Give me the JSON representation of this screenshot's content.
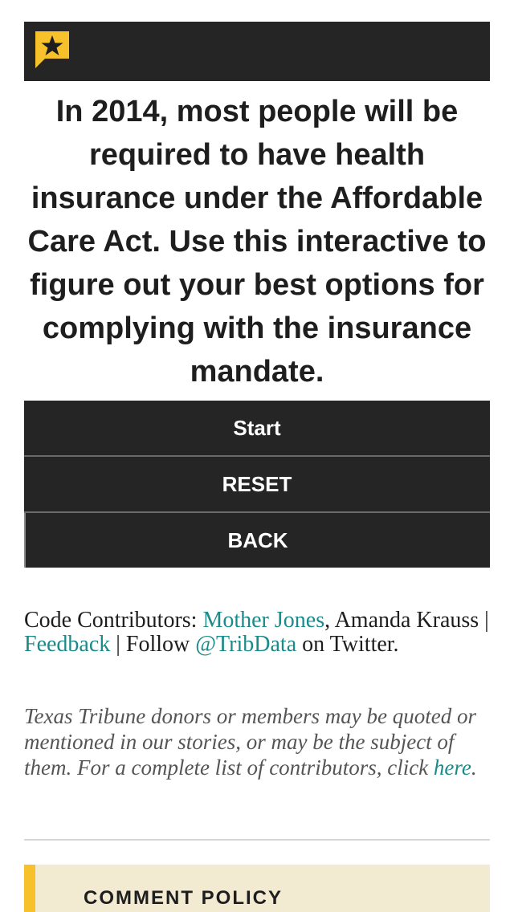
{
  "intro": {
    "text": "In 2014, most people will be required to have health insurance under the Affordable Care Act. Use this interactive to figure out your best options for complying with the insurance mandate."
  },
  "buttons": {
    "start": "Start",
    "reset": "RESET",
    "back": "BACK"
  },
  "credits": {
    "prefix": "Code Contributors: ",
    "mother_jones": "Mother Jones",
    "after_mj": ", Amanda Krauss | ",
    "feedback": "Feedback",
    "follow": " | Follow ",
    "tribdata": "@TribData",
    "suffix": " on Twitter."
  },
  "disclaimer": {
    "text": "Texas Tribune donors or members may be quoted or mentioned in our stories, or may be the subject of them. For a complete list of contributors, click ",
    "link": "here",
    "end": "."
  },
  "comment_policy": {
    "title": "COMMENT POLICY"
  },
  "colors": {
    "dark": "#252525",
    "link": "#1b8a8a",
    "accent_yellow": "#f6c12b",
    "comment_bg": "#f3ead2"
  },
  "icons": {
    "logo": "star-flag-icon"
  }
}
